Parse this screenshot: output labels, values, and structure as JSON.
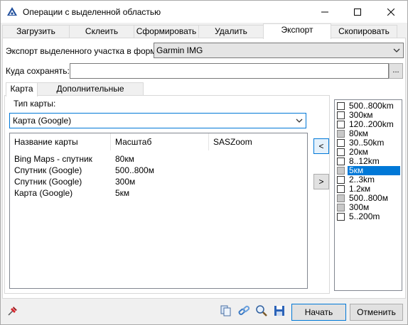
{
  "window": {
    "title": "Операции с выделенной областью"
  },
  "tabs": [
    "Загрузить",
    "Склеить",
    "Сформировать",
    "Удалить",
    "Экспорт",
    "Скопировать"
  ],
  "active_tab": "Экспорт",
  "export": {
    "format_label": "Экспорт выделенного участка в формат",
    "format_value": "Garmin IMG",
    "save_to_label": "Куда сохранять:",
    "save_to_value": "",
    "browse_label": "..."
  },
  "subtabs": [
    "Карта",
    "Дополнительные операции"
  ],
  "map_tab": {
    "map_type_label": "Тип карты:",
    "map_type_value": "Карта (Google)",
    "columns": [
      "Название карты",
      "Масштаб",
      "SASZoom"
    ],
    "rows": [
      {
        "name": "Bing Maps - спутник",
        "scale": "80км",
        "saszoom": ""
      },
      {
        "name": "Спутник (Google)",
        "scale": "500..800м",
        "saszoom": ""
      },
      {
        "name": "Спутник (Google)",
        "scale": "300м",
        "saszoom": ""
      },
      {
        "name": "Карта (Google)",
        "scale": "5км",
        "saszoom": ""
      }
    ],
    "add_button": "<",
    "remove_button": ">"
  },
  "scales": [
    {
      "label": "500..800km",
      "state": "unchecked"
    },
    {
      "label": "300км",
      "state": "unchecked"
    },
    {
      "label": "120..200km",
      "state": "unchecked"
    },
    {
      "label": "80км",
      "state": "disabled"
    },
    {
      "label": "30..50km",
      "state": "unchecked"
    },
    {
      "label": "20км",
      "state": "unchecked"
    },
    {
      "label": "8..12km",
      "state": "unchecked"
    },
    {
      "label": "5км",
      "state": "disabled",
      "selected": true
    },
    {
      "label": "2..3km",
      "state": "unchecked"
    },
    {
      "label": "1.2км",
      "state": "unchecked"
    },
    {
      "label": "500..800м",
      "state": "disabled"
    },
    {
      "label": "300м",
      "state": "disabled"
    },
    {
      "label": "5..200m",
      "state": "unchecked"
    }
  ],
  "footer": {
    "start_button": "Начать",
    "cancel_button": "Отменить"
  },
  "colors": {
    "selection": "#0078d7",
    "pin": "#d9262c"
  }
}
